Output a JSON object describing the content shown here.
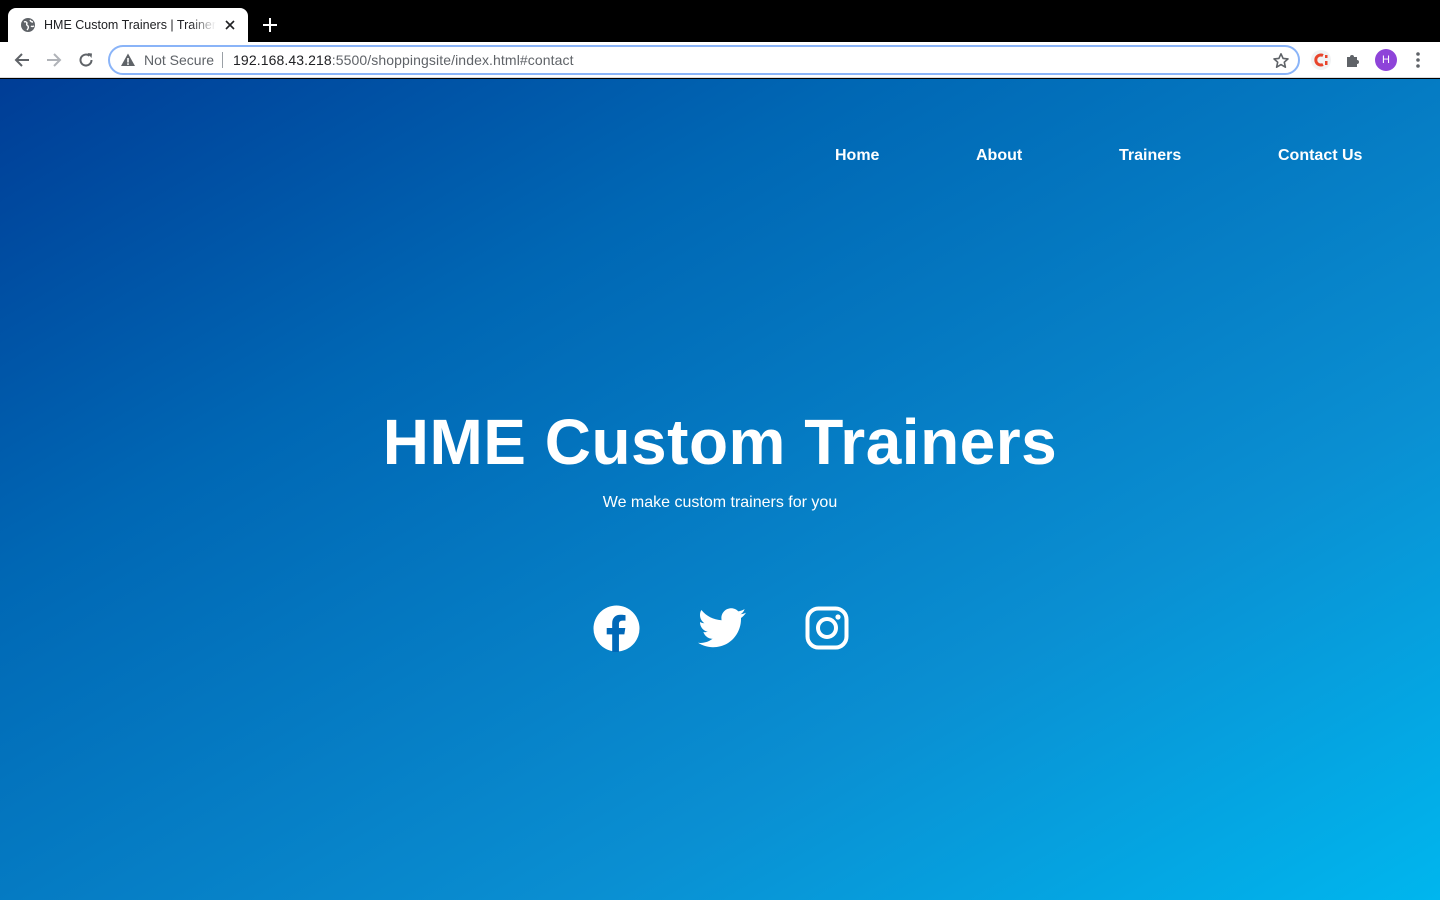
{
  "browser": {
    "tab_title": "HME Custom Trainers | Trainers",
    "security_label": "Not Secure",
    "url_host": "192.168.43.218",
    "url_rest": ":5500/shoppingsite/index.html#contact",
    "avatar_letter": "H",
    "icons": [
      "globe-icon",
      "close-icon",
      "plus-icon",
      "back-icon",
      "forward-icon",
      "reload-icon",
      "warning-icon",
      "star-icon",
      "extension-icon",
      "puzzle-icon",
      "more-icon"
    ]
  },
  "nav": {
    "items": [
      {
        "label": "Home"
      },
      {
        "label": "About"
      },
      {
        "label": "Trainers"
      },
      {
        "label": "Contact Us"
      }
    ]
  },
  "hero": {
    "title": "HME Custom Trainers",
    "subtitle": "We make custom trainers for you"
  },
  "social": {
    "icons": [
      "facebook-icon",
      "twitter-icon",
      "instagram-icon"
    ]
  },
  "colors": {
    "gradient_start": "#003d96",
    "gradient_end": "#00b6ee",
    "text": "#ffffff",
    "avatar": "#8e44d9",
    "omnibox_focus": "#8ab4f8"
  }
}
